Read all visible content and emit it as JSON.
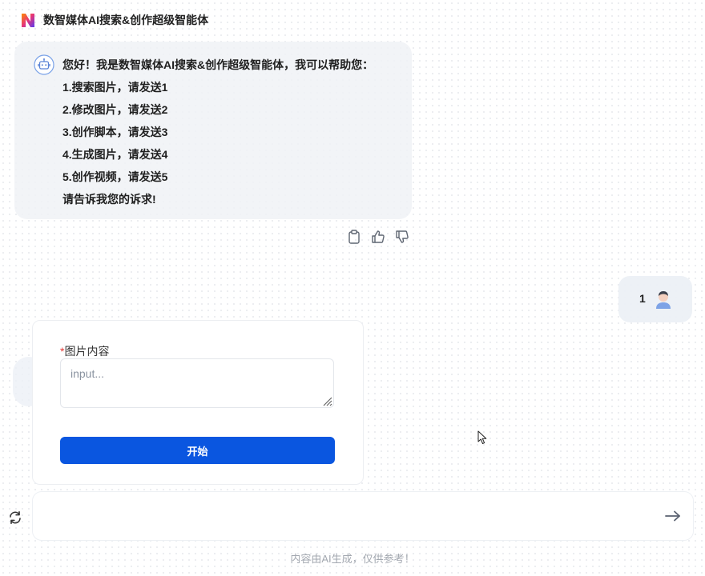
{
  "app": {
    "title": "数智媒体AI搜索&创作超级智能体"
  },
  "bot_message": {
    "lines": [
      "您好！我是数智媒体AI搜索&创作超级智能体，我可以帮助您：",
      "1.搜索图片，请发送1",
      "2.修改图片，请发送2",
      "3.创作脚本，请发送3",
      "4.生成图片，请发送4",
      "5.创作视频，请发送5",
      "请告诉我您的诉求!"
    ]
  },
  "actions": {
    "icons": [
      "clipboard-icon",
      "thumbs-up-icon",
      "thumbs-down-icon"
    ]
  },
  "user_message": {
    "text": "1"
  },
  "form": {
    "required_mark": "*",
    "label": "图片内容",
    "value": "",
    "placeholder": "input...",
    "submit_label": "开始"
  },
  "chat_input": {
    "value": "",
    "placeholder": ""
  },
  "footer": {
    "disclaimer": "内容由AI生成，仅供参考！"
  },
  "colors": {
    "accent": "#0a56e0",
    "required": "#e53935",
    "bubble_bg": "#f0f2f6"
  }
}
